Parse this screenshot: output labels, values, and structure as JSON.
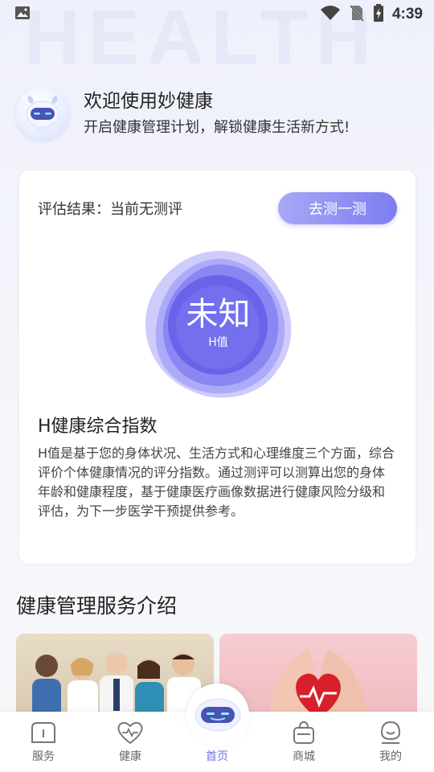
{
  "watermark": "HEALTH",
  "status_bar": {
    "time": "4:39"
  },
  "greeting": {
    "title": "欢迎使用妙健康",
    "subtitle": "开启健康管理计划，解锁健康生活新方式!"
  },
  "assessment": {
    "label": "评估结果：当前无测评",
    "button": "去测一测",
    "h_value": "未知",
    "h_label": "H值"
  },
  "index_info": {
    "title": "H健康综合指数",
    "description": "H值是基于您的身体状况、生活方式和心理维度三个方面，综合评价个体健康情况的评分指数。通过测评可以测算出您的身体年龄和健康程度，基于健康医疗画像数据进行健康风险分级和评估，为下一步医学干预提供参考。"
  },
  "services": {
    "title": "健康管理服务介绍"
  },
  "tabs": [
    {
      "label": "服务",
      "icon": "service-icon",
      "active": false
    },
    {
      "label": "健康",
      "icon": "heart-icon",
      "active": false
    },
    {
      "label": "首页",
      "icon": "robot-icon",
      "active": true
    },
    {
      "label": "商城",
      "icon": "shopping-bag-icon",
      "active": false
    },
    {
      "label": "我的",
      "icon": "profile-icon",
      "active": false
    }
  ],
  "colors": {
    "accent": "#7d7df0",
    "active_tab": "#6e6ff0"
  }
}
